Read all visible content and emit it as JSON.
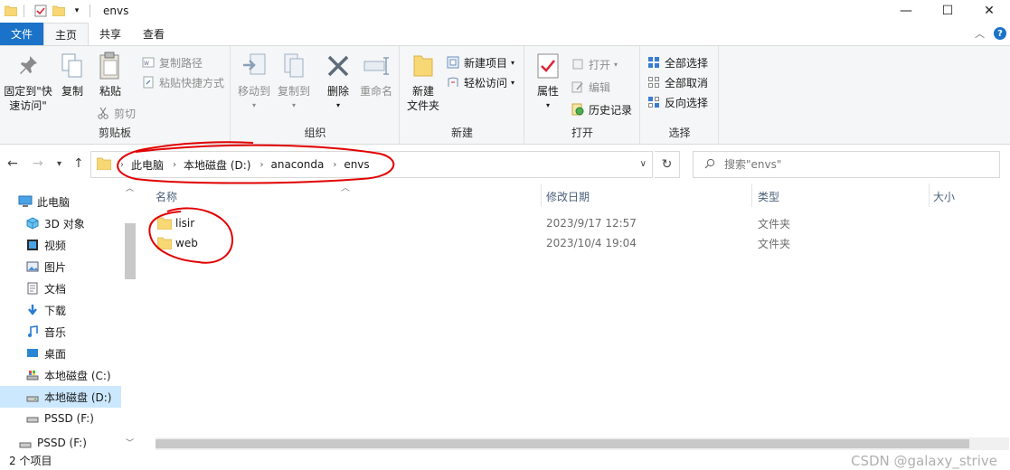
{
  "window": {
    "title": "envs",
    "controls": {
      "minimize": "—",
      "maximize": "☐",
      "close": "✕"
    }
  },
  "ribbon_tabs": [
    "文件",
    "主页",
    "共享",
    "查看"
  ],
  "ribbon": {
    "clipboard": {
      "label": "剪贴板",
      "pin_line1": "固定到\"快",
      "pin_line2": "速访问\"",
      "copy": "复制",
      "paste": "粘贴",
      "copy_path": "复制路径",
      "paste_shortcut": "粘贴快捷方式",
      "cut": "剪切"
    },
    "organize": {
      "label": "组织",
      "move_to": "移动到",
      "copy_to": "复制到",
      "delete": "删除",
      "rename": "重命名"
    },
    "new": {
      "label": "新建",
      "new_folder_line1": "新建",
      "new_folder_line2": "文件夹",
      "new_item": "新建项目",
      "easy_access": "轻松访问"
    },
    "open": {
      "label": "打开",
      "properties": "属性",
      "open": "打开",
      "edit": "编辑",
      "history": "历史记录"
    },
    "select": {
      "label": "选择",
      "select_all": "全部选择",
      "select_none": "全部取消",
      "invert": "反向选择"
    }
  },
  "address": {
    "crumbs": [
      "此电脑",
      "本地磁盘 (D:)",
      "anaconda",
      "envs"
    ],
    "search_placeholder": "搜索\"envs\""
  },
  "sidebar": {
    "items": [
      {
        "label": "此电脑",
        "icon": "computer-icon"
      },
      {
        "label": "3D 对象",
        "icon": "cube-icon"
      },
      {
        "label": "视频",
        "icon": "video-icon"
      },
      {
        "label": "图片",
        "icon": "picture-icon"
      },
      {
        "label": "文档",
        "icon": "document-icon"
      },
      {
        "label": "下载",
        "icon": "download-icon"
      },
      {
        "label": "音乐",
        "icon": "music-icon"
      },
      {
        "label": "桌面",
        "icon": "desktop-icon"
      },
      {
        "label": "本地磁盘 (C:)",
        "icon": "drive-icon"
      },
      {
        "label": "本地磁盘 (D:)",
        "icon": "drive-icon"
      },
      {
        "label": "PSSD (F:)",
        "icon": "usb-drive-icon"
      },
      {
        "label": "PSSD (F:)",
        "icon": "usb-drive-icon"
      }
    ],
    "selected_index": 9
  },
  "columns": [
    "名称",
    "修改日期",
    "类型",
    "大小"
  ],
  "files": [
    {
      "name": "lisir",
      "modified": "2023/9/17 12:57",
      "type": "文件夹"
    },
    {
      "name": "web",
      "modified": "2023/10/4 19:04",
      "type": "文件夹"
    }
  ],
  "status": {
    "count": "2 个项目"
  },
  "watermark": "CSDN @galaxy_strive",
  "colors": {
    "accent": "#1a73c8",
    "selection": "#cce8ff",
    "folder": "#f8d775",
    "annotation": "#e00000"
  }
}
